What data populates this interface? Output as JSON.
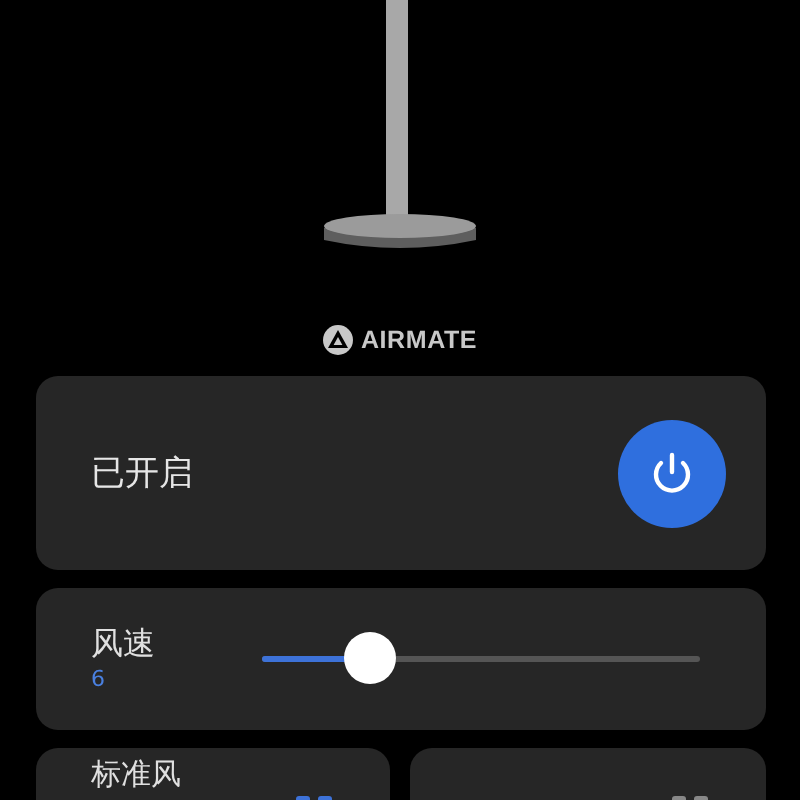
{
  "brand": "AIRMATE",
  "power": {
    "label": "已开启",
    "on": true
  },
  "speed": {
    "label": "风速",
    "value": "6",
    "level": 0.25
  },
  "modes": [
    {
      "label": "标准风",
      "selected": true
    },
    {
      "selected": false
    }
  ]
}
